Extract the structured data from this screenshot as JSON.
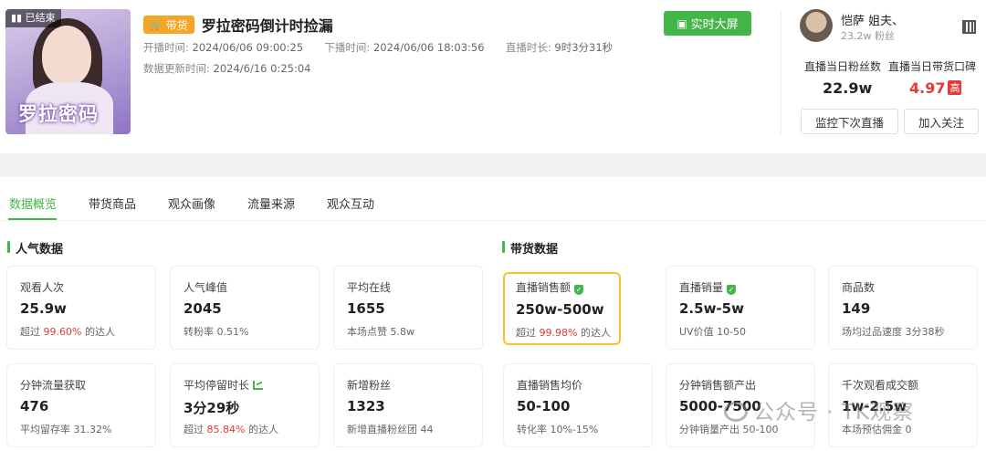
{
  "cover": {
    "status_badge": "已结束",
    "logo_text": "罗拉密码"
  },
  "live": {
    "tag": "带货",
    "title": "罗拉密码倒计时捡漏",
    "start_label": "开播时间:",
    "start_time": "2024/06/06 09:00:25",
    "end_label": "下播时间:",
    "end_time": "2024/06/06 18:03:56",
    "duration_label": "直播时长:",
    "duration": "9时3分31秒",
    "update_label": "数据更新时间:",
    "update_time": "2024/6/16 0:25:04",
    "realtime_button": "实时大屏"
  },
  "streamer": {
    "name": "恺萨 姐夫、",
    "fans": "23.2w 粉丝",
    "fans_label": "直播当日粉丝数",
    "fans_value": "22.9w",
    "rating_label": "直播当日带货口碑",
    "rating_value": "4.97",
    "rating_badge": "高",
    "monitor_button": "监控下次直播",
    "follow_button": "加入关注"
  },
  "tabs": [
    "数据概览",
    "带货商品",
    "观众画像",
    "流量来源",
    "观众互动"
  ],
  "sections": {
    "popularity": "人气数据",
    "sales": "带货数据"
  },
  "cards": [
    {
      "label": "观看人次",
      "value": "25.9w",
      "sub_pre": "超过 ",
      "sub_hl": "99.60%",
      "sub_post": " 的达人"
    },
    {
      "label": "人气峰值",
      "value": "2045",
      "sub_pre": "转粉率 0.51%",
      "sub_hl": "",
      "sub_post": ""
    },
    {
      "label": "平均在线",
      "value": "1655",
      "sub_pre": "本场点赞 5.8w",
      "sub_hl": "",
      "sub_post": ""
    },
    {
      "label": "直播销售额",
      "value": "250w-500w",
      "sub_pre": "超过 ",
      "sub_hl": "99.98%",
      "sub_post": " 的达人"
    },
    {
      "label": "直播销量",
      "value": "2.5w-5w",
      "sub_pre": "UV价值 10-50",
      "sub_hl": "",
      "sub_post": ""
    },
    {
      "label": "商品数",
      "value": "149",
      "sub_pre": "场均过品速度 3分38秒",
      "sub_hl": "",
      "sub_post": ""
    },
    {
      "label": "分钟流量获取",
      "value": "476",
      "sub_pre": "平均留存率 31.32%",
      "sub_hl": "",
      "sub_post": ""
    },
    {
      "label": "平均停留时长",
      "value": "3分29秒",
      "sub_pre": "超过 ",
      "sub_hl": "85.84%",
      "sub_post": " 的达人"
    },
    {
      "label": "新增粉丝",
      "value": "1323",
      "sub_pre": "新增直播粉丝团 44",
      "sub_hl": "",
      "sub_post": ""
    },
    {
      "label": "直播销售均价",
      "value": "50-100",
      "sub_pre": "转化率 10%-15%",
      "sub_hl": "",
      "sub_post": ""
    },
    {
      "label": "分钟销售额产出",
      "value": "5000-7500",
      "sub_pre": "分钟销量产出 50-100",
      "sub_hl": "",
      "sub_post": ""
    },
    {
      "label": "千次观看成交额",
      "value": "1w-2.5w",
      "sub_pre": "本场预估佣金 0",
      "sub_hl": "",
      "sub_post": ""
    }
  ],
  "watermark": "公众号 · TK观察",
  "colors": {
    "accent": "#43b549",
    "highlight": "#f3c331",
    "red": "#e33a3a",
    "tag": "#f7a623"
  }
}
